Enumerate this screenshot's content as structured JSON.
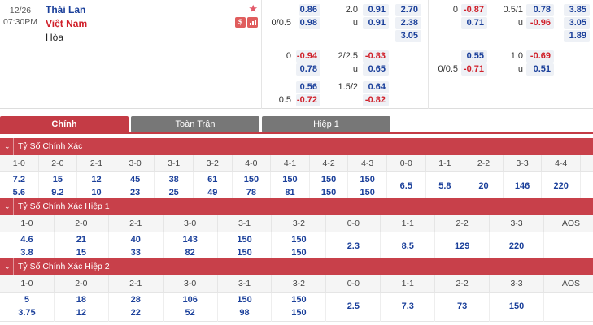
{
  "match": {
    "date": "12/26",
    "time": "07:30PM",
    "home": "Thái Lan",
    "away": "Việt Nam",
    "draw": "Hòa",
    "badge_money": "$"
  },
  "odds": {
    "h_label": "0/0.5",
    "h_home": "0.86",
    "h_away": "0.98",
    "ou_line": "2.0",
    "ou_over": "0.91",
    "ou_under_label": "u",
    "ou_under": "0.91",
    "x_home": "2.70",
    "x_away": "2.38",
    "x_draw": "3.05",
    "r2_hlabel": "0",
    "r2_h1": "-0.94",
    "r2_h2": "0.78",
    "r2_ouline": "2/2.5",
    "r2_o": "-0.83",
    "r2_ulabel": "u",
    "r2_u": "0.65",
    "r3_hlabel": "0.5",
    "r3_h1": "0.56",
    "r3_h2": "-0.72",
    "r3_ouline": "1.5/2",
    "r3_o": "0.64",
    "r3_u": "-0.82",
    "fh_hlabel": "0",
    "fh_h1": "-0.87",
    "fh_h2": "0.71",
    "fh_ouline": "0.5/1",
    "fh_o": "0.78",
    "fh_ulabel": "u",
    "fh_u": "-0.96",
    "fh_x1": "3.85",
    "fh_x2": "3.05",
    "fh_x3": "1.89",
    "fh2_hlabel": "0/0.5",
    "fh2_h1": "0.55",
    "fh2_h2": "-0.71",
    "fh2_ouline": "1.0",
    "fh2_o": "-0.69",
    "fh2_ulabel": "u",
    "fh2_u": "0.51"
  },
  "tabs": [
    "Chính",
    "Toàn Trận",
    "Hiệp 1"
  ],
  "sections": [
    {
      "title": "Tỷ Số Chính Xác",
      "headers": [
        "1-0",
        "2-0",
        "2-1",
        "3-0",
        "3-1",
        "3-2",
        "4-0",
        "4-1",
        "4-2",
        "4-3",
        "0-0",
        "1-1",
        "2-2",
        "3-3",
        "4-4"
      ],
      "top": [
        "7.2",
        "15",
        "12",
        "45",
        "38",
        "61",
        "150",
        "150",
        "150",
        "150",
        "",
        "",
        "",
        "",
        ""
      ],
      "bot": [
        "5.6",
        "9.2",
        "10",
        "23",
        "25",
        "49",
        "78",
        "81",
        "150",
        "150",
        "",
        "",
        "",
        "",
        ""
      ],
      "mid": [
        "",
        "",
        "",
        "",
        "",
        "",
        "",
        "",
        "",
        "",
        "6.5",
        "5.8",
        "20",
        "146",
        "220"
      ]
    },
    {
      "title": "Tỷ Số Chính Xác Hiệp 1",
      "headers": [
        "1-0",
        "2-0",
        "2-1",
        "3-0",
        "3-1",
        "3-2",
        "0-0",
        "1-1",
        "2-2",
        "3-3",
        "AOS"
      ],
      "top": [
        "4.6",
        "21",
        "40",
        "143",
        "150",
        "150",
        "",
        "",
        "",
        "",
        ""
      ],
      "bot": [
        "3.8",
        "15",
        "33",
        "82",
        "150",
        "150",
        "",
        "",
        "",
        "",
        ""
      ],
      "mid": [
        "",
        "",
        "",
        "",
        "",
        "",
        "2.3",
        "8.5",
        "129",
        "220",
        ""
      ]
    },
    {
      "title": "Tỷ Số Chính Xác Hiệp 2",
      "headers": [
        "1-0",
        "2-0",
        "2-1",
        "3-0",
        "3-1",
        "3-2",
        "0-0",
        "1-1",
        "2-2",
        "3-3",
        "AOS"
      ],
      "top": [
        "5",
        "18",
        "28",
        "106",
        "150",
        "150",
        "",
        "",
        "",
        "",
        ""
      ],
      "bot": [
        "3.75",
        "12",
        "22",
        "52",
        "98",
        "150",
        "",
        "",
        "",
        "",
        ""
      ],
      "mid": [
        "",
        "",
        "",
        "",
        "",
        "",
        "2.5",
        "7.3",
        "73",
        "150",
        ""
      ]
    }
  ],
  "colors": {
    "accent": "#c8404a",
    "home": "#1a3f9a",
    "away": "#d0202a",
    "tab_off": "#777777"
  }
}
